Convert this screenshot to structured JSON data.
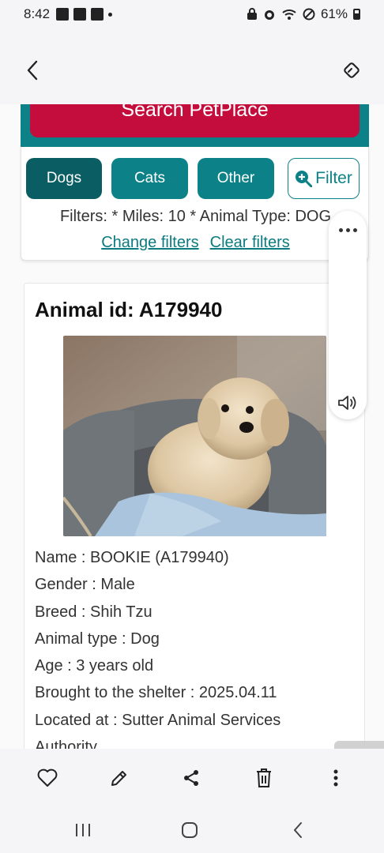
{
  "status_bar": {
    "time": "8:42",
    "battery": "61%"
  },
  "search": {
    "button_label": "Search PetPlace"
  },
  "filters": {
    "chips": [
      {
        "label": "Dogs"
      },
      {
        "label": "Cats"
      },
      {
        "label": "Other"
      }
    ],
    "filter_button_label": "Filter",
    "summary": "Filters: * Miles: 10 * Animal Type: DOG",
    "change_link": "Change filters",
    "clear_link": "Clear filters"
  },
  "animal": {
    "title": "Animal id: A179940",
    "details": [
      "Name : BOOKIE (A179940)",
      "Gender : Male",
      "Breed : Shih Tzu",
      "Animal type : Dog",
      "Age : 3 years old",
      "Brought to the shelter : 2025.04.11",
      "Located at : Sutter Animal Services",
      "Authority"
    ]
  },
  "icons": {
    "back": "chevron-left-icon",
    "rotate": "screen-rotate-icon",
    "more": "more-horizontal-icon",
    "volume": "volume-icon",
    "favorite": "heart-icon",
    "edit": "pencil-icon",
    "share": "share-icon",
    "delete": "trash-icon",
    "menu": "more-vertical-icon"
  },
  "colors": {
    "teal": "#0c8288",
    "teal_dark": "#0a5e63",
    "crimson": "#c40d3c"
  }
}
